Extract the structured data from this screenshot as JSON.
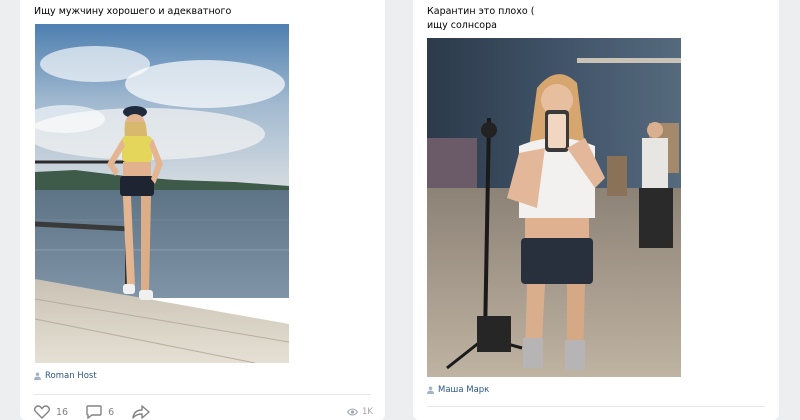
{
  "posts": [
    {
      "text": "Ищу мужчину хорошего и адекватного",
      "author": "Roman Host",
      "likes": "16",
      "comments": "6",
      "views": "1K"
    },
    {
      "text": "Карантин это плохо (\nищу солнсора",
      "author": "Маша Марк"
    }
  ],
  "icons": {
    "user": "user-icon",
    "like": "heart-icon",
    "comment": "comment-icon",
    "share": "share-arrow-icon",
    "views": "eye-icon"
  },
  "colors": {
    "background": "#edeef0",
    "card": "#ffffff",
    "link": "#2a5885",
    "muted": "#828282"
  }
}
